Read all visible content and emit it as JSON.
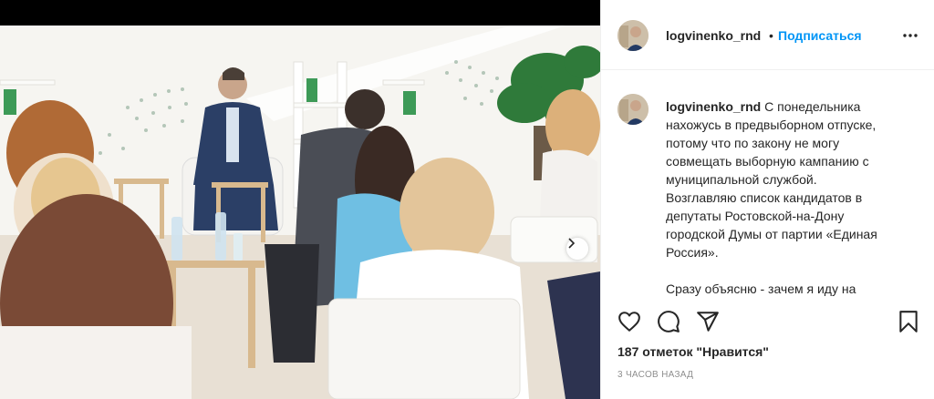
{
  "post": {
    "username": "logvinenko_rnd",
    "separator": "•",
    "follow_label": "Подписаться",
    "more_icon": "more-horizontal-icon",
    "caption_username": "logvinenko_rnd",
    "caption_lines": [
      "С понедельника",
      "нахожусь в предвыборном отпуске,",
      "потому что по закону не могу",
      "совмещать выборную кампанию с",
      "муниципальной службой.",
      "Возглавляю список кандидатов в",
      "депутаты Ростовской-на-Дону",
      "городской Думы от партии «Единая",
      "Россия».",
      "",
      "Сразу объясню - зачем я иду на"
    ],
    "likes_text": "187 отметок \"Нравится\"",
    "time_ago": "3 ЧАСОВ НАЗАД"
  },
  "icons": {
    "like": "heart-icon",
    "comment": "comment-icon",
    "share": "share-icon",
    "save": "bookmark-icon",
    "next": "chevron-right-icon"
  },
  "colors": {
    "follow": "#0095f6",
    "text": "#262626",
    "muted": "#8e8e8e"
  }
}
